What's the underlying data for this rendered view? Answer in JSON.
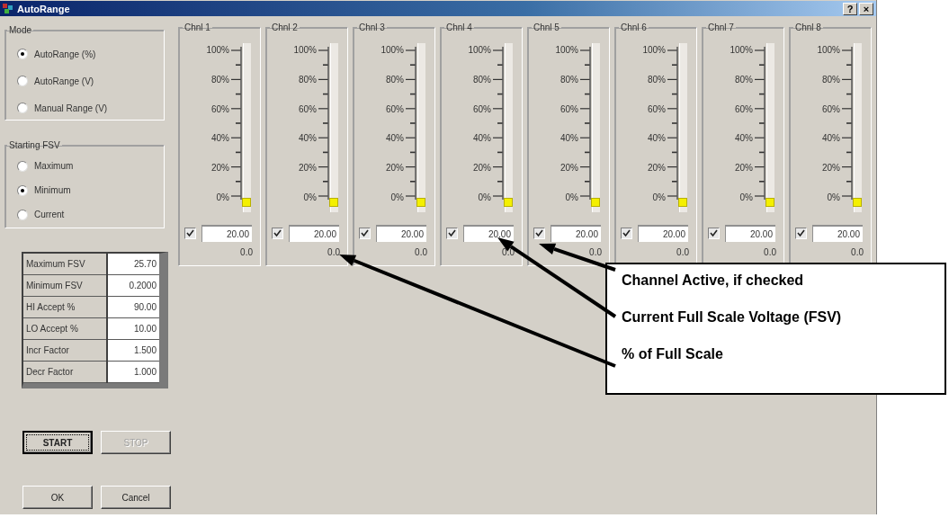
{
  "window": {
    "title": "AutoRange",
    "help_button": "?",
    "close_button": "×"
  },
  "mode": {
    "title": "Mode",
    "options": [
      {
        "label": "AutoRange (%)",
        "selected": true
      },
      {
        "label": "AutoRange (V)",
        "selected": false
      },
      {
        "label": "Manual Range (V)",
        "selected": false
      }
    ]
  },
  "starting_fsv": {
    "title": "Starting FSV",
    "options": [
      {
        "label": "Maximum",
        "selected": false
      },
      {
        "label": "Minimum",
        "selected": true
      },
      {
        "label": "Current",
        "selected": false
      }
    ]
  },
  "parameters": [
    {
      "label": "Maximum FSV",
      "value": "25.70"
    },
    {
      "label": "Minimum FSV",
      "value": "0.2000"
    },
    {
      "label": "HI Accept %",
      "value": "90.00"
    },
    {
      "label": "LO Accept %",
      "value": "10.00"
    },
    {
      "label": "Incr Factor",
      "value": "1.500"
    },
    {
      "label": "Decr Factor",
      "value": "1.000"
    }
  ],
  "run_buttons": [
    {
      "label": "START",
      "disabled": false,
      "focused": true
    },
    {
      "label": "STOP",
      "disabled": true,
      "focused": false
    }
  ],
  "dialog_buttons": [
    {
      "label": "OK"
    },
    {
      "label": "Cancel"
    }
  ],
  "channels": [
    {
      "name": "Chnl 1",
      "scale": [
        "100%",
        "80%",
        "60%",
        "40%",
        "20%",
        "0%"
      ],
      "level": 0,
      "active": true,
      "fsv": "20.00",
      "percent": "0.0"
    },
    {
      "name": "Chnl 2",
      "scale": [
        "100%",
        "80%",
        "60%",
        "40%",
        "20%",
        "0%"
      ],
      "level": 0,
      "active": true,
      "fsv": "20.00",
      "percent": "0.0"
    },
    {
      "name": "Chnl 3",
      "scale": [
        "100%",
        "80%",
        "60%",
        "40%",
        "20%",
        "0%"
      ],
      "level": 0,
      "active": true,
      "fsv": "20.00",
      "percent": "0.0"
    },
    {
      "name": "Chnl 4",
      "scale": [
        "100%",
        "80%",
        "60%",
        "40%",
        "20%",
        "0%"
      ],
      "level": 0,
      "active": true,
      "fsv": "20.00",
      "percent": "0.0"
    },
    {
      "name": "Chnl 5",
      "scale": [
        "100%",
        "80%",
        "60%",
        "40%",
        "20%",
        "0%"
      ],
      "level": 0,
      "active": true,
      "fsv": "20.00",
      "percent": "0.0"
    },
    {
      "name": "Chnl 6",
      "scale": [
        "100%",
        "80%",
        "60%",
        "40%",
        "20%",
        "0%"
      ],
      "level": 0,
      "active": true,
      "fsv": "20.00",
      "percent": "0.0"
    },
    {
      "name": "Chnl 7",
      "scale": [
        "100%",
        "80%",
        "60%",
        "40%",
        "20%",
        "0%"
      ],
      "level": 0,
      "active": true,
      "fsv": "20.00",
      "percent": "0.0"
    },
    {
      "name": "Chnl 8",
      "scale": [
        "100%",
        "80%",
        "60%",
        "40%",
        "20%",
        "0%"
      ],
      "level": 0,
      "active": true,
      "fsv": "20.00",
      "percent": "0.0"
    }
  ],
  "annotations": [
    {
      "text": "Channel Active, if checked"
    },
    {
      "text": "Current Full Scale Voltage (FSV)"
    },
    {
      "text": "% of Full Scale"
    }
  ]
}
